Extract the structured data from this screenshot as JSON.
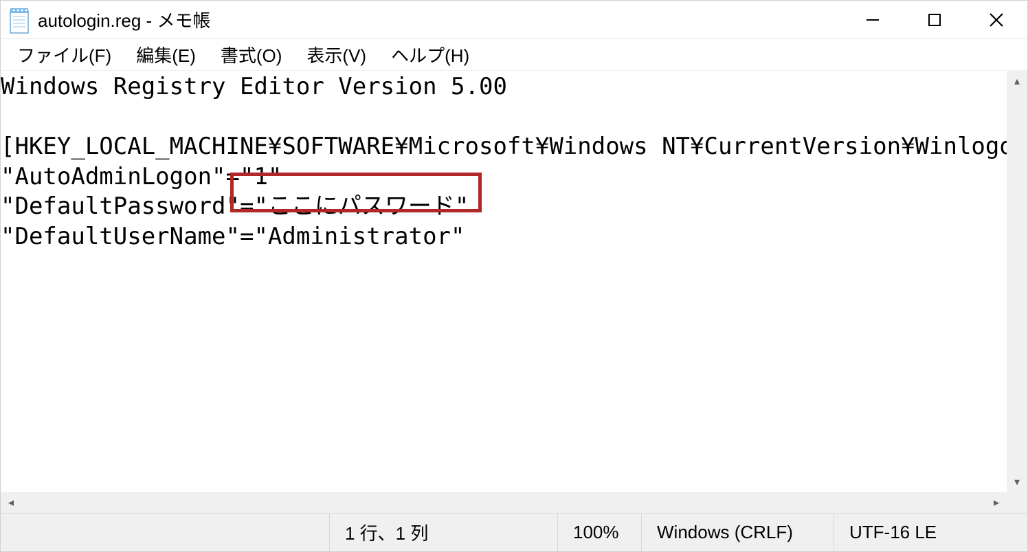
{
  "titlebar": {
    "title": "autologin.reg - メモ帳"
  },
  "menu": {
    "file": "ファイル(F)",
    "edit": "編集(E)",
    "format": "書式(O)",
    "view": "表示(V)",
    "help": "ヘルプ(H)"
  },
  "content": {
    "line1": "Windows Registry Editor Version 5.00",
    "line2": "",
    "line3": "[HKEY_LOCAL_MACHINE¥SOFTWARE¥Microsoft¥Windows NT¥CurrentVersion¥Winlogon]",
    "line4": "\"AutoAdminLogon\"=\"1\"",
    "line5": "\"DefaultPassword\"=\"ここにパスワード\"",
    "line6": "\"DefaultUserName\"=\"Administrator\""
  },
  "statusbar": {
    "position": "1 行、1 列",
    "zoom": "100%",
    "eol": "Windows (CRLF)",
    "encoding": "UTF-16 LE"
  },
  "highlight": {
    "target_text": "\"ここにパスワード\""
  }
}
